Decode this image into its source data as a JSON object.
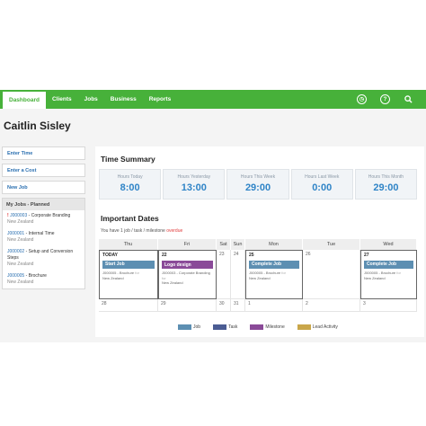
{
  "nav": {
    "tabs": [
      "Dashboard",
      "Clients",
      "Jobs",
      "Business",
      "Reports"
    ],
    "icons": [
      "clock-icon",
      "help-icon",
      "search-icon"
    ]
  },
  "user_name": "Caitlin Sisley",
  "left": {
    "buttons": [
      "Enter Time",
      "Enter a Cost",
      "New Job"
    ],
    "planned_title": "My Jobs - Planned",
    "jobs": [
      {
        "code": "J000003",
        "name": "Corporate Branding",
        "client": "New Zealand",
        "flag": "!"
      },
      {
        "code": "J000001",
        "name": "Internal Time",
        "client": "New Zealand",
        "flag": ""
      },
      {
        "code": "J000002",
        "name": "Setup and Conversion Steps",
        "client": "New Zealand",
        "flag": ""
      },
      {
        "code": "J000005",
        "name": "Brochure",
        "client": "New Zealand",
        "flag": ""
      }
    ]
  },
  "time_summary": {
    "title": "Time Summary",
    "boxes": [
      {
        "label": "Hours Today",
        "value": "8:00"
      },
      {
        "label": "Hours Yesterday",
        "value": "13:00"
      },
      {
        "label": "Hours This Week",
        "value": "29:00"
      },
      {
        "label": "Hours Last Week",
        "value": "0:00"
      },
      {
        "label": "Hours This Month",
        "value": "29:00"
      }
    ]
  },
  "important_dates": {
    "title": "Important Dates",
    "note": "You have 1 job / task / milestone",
    "note_overdue": "overdue",
    "days": [
      "Thu",
      "Fri",
      "Sat",
      "Sun",
      "Mon",
      "Tue",
      "Wed"
    ],
    "row1": [
      {
        "day": "TODAY",
        "event": "Start Job",
        "type": "job",
        "sub1": "J000005 - Brochure",
        "sub_for": "for",
        "sub2": "New Zealand"
      },
      {
        "day": "22",
        "event": "Logo design",
        "type": "milestone",
        "sub1": "J000003 - Corporate Branding",
        "sub_for": "for",
        "sub2": "New Zealand"
      },
      {
        "day": "23"
      },
      {
        "day": "24"
      },
      {
        "day": "25",
        "event": "Complete Job",
        "type": "job",
        "sub1": "J000005 - Brochure",
        "sub_for": "for",
        "sub2": "New Zealand"
      },
      {
        "day": "26"
      },
      {
        "day": "27",
        "event": "Complete Job",
        "type": "job",
        "sub1": "J000005 - Brochure",
        "sub_for": "for",
        "sub2": "New Zealand"
      }
    ],
    "row2": [
      "28",
      "29",
      "30",
      "31",
      "1",
      "2",
      "3"
    ],
    "legend": [
      {
        "label": "Job",
        "color": "#5d8fb2"
      },
      {
        "label": "Task",
        "color": "#4b5c93"
      },
      {
        "label": "Milestone",
        "color": "#8a4a98"
      },
      {
        "label": "Lead Activity",
        "color": "#c9a64a"
      }
    ]
  }
}
